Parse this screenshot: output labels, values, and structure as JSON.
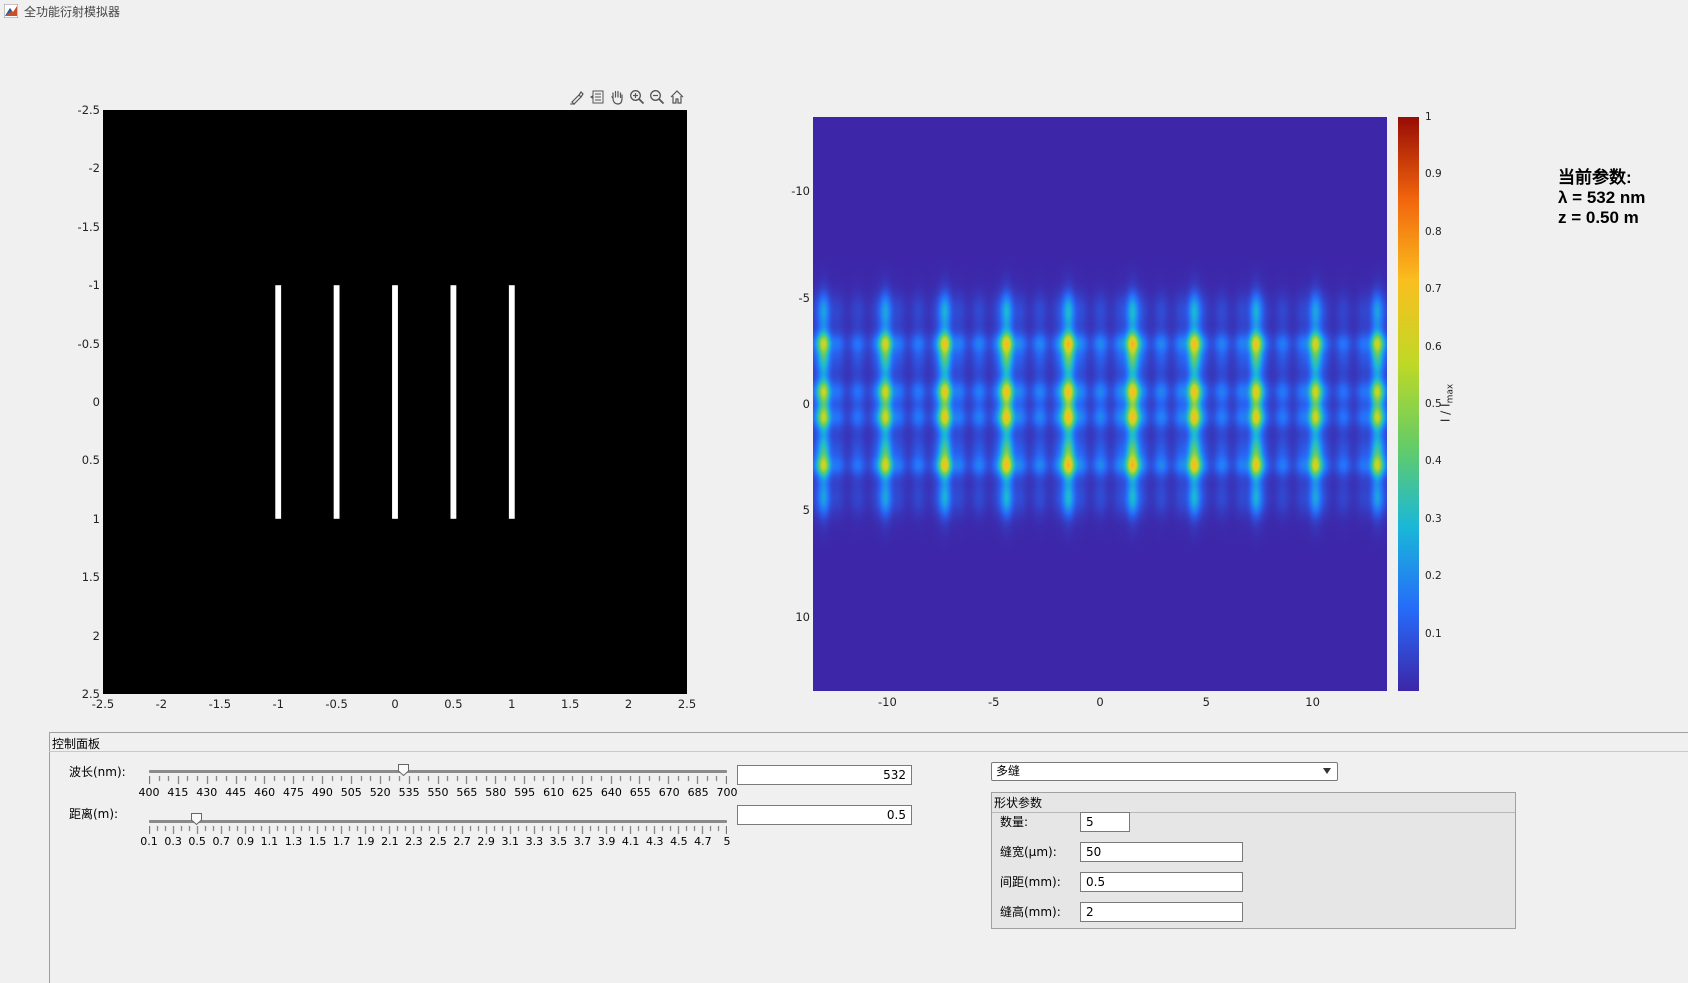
{
  "window": {
    "title": "全功能衍射模拟器"
  },
  "toolbar": {
    "icons": [
      "brush-icon",
      "datatip-icon",
      "pan-icon",
      "zoom-in-icon",
      "zoom-out-icon",
      "home-icon"
    ]
  },
  "aperture_plot": {
    "x_ticks": [
      "-2.5",
      "-2",
      "-1.5",
      "-1",
      "-0.5",
      "0",
      "0.5",
      "1",
      "1.5",
      "2",
      "2.5"
    ],
    "y_ticks": [
      "-2.5",
      "-2",
      "-1.5",
      "-1",
      "-0.5",
      "0",
      "0.5",
      "1",
      "1.5",
      "2",
      "2.5"
    ],
    "background": "#000000",
    "slit_color": "#ffffff"
  },
  "chart_data": [
    {
      "type": "heatmap",
      "title": "",
      "xlim": [
        -13.5,
        13.5
      ],
      "ylim": [
        13.5,
        -13.5
      ],
      "x_ticks": [
        "-10",
        "-5",
        "0",
        "5",
        "10"
      ],
      "y_ticks": [
        "-10",
        "-5",
        "0",
        "5",
        "10"
      ],
      "colormap": "parula",
      "colorbar": {
        "label": "I / I",
        "label_sub": "max",
        "ticks": [
          "0.1",
          "0.2",
          "0.3",
          "0.4",
          "0.5",
          "0.6",
          "0.7",
          "0.8",
          "0.9",
          "1"
        ],
        "range": [
          0,
          1
        ]
      },
      "fringe_x_positions": [
        -13.0,
        -10.1,
        -7.3,
        -4.4,
        -1.5,
        1.5,
        4.4,
        7.3,
        10.1,
        13.0
      ],
      "fringe_y_positions": [
        -3.0,
        -0.75,
        0.75,
        3.0
      ]
    }
  ],
  "params": {
    "heading": "当前参数:",
    "wavelength": "λ = 532 nm",
    "distance": "z = 0.50 m"
  },
  "control_panel": {
    "title": "控制面板",
    "wavelength_label": "波长(nm):",
    "wavelength_value": "532",
    "wavelength_min": 400,
    "wavelength_max": 700,
    "wavelength_tick_labels": [
      "400",
      "415",
      "430",
      "445",
      "460",
      "475",
      "490",
      "505",
      "520",
      "535",
      "550",
      "565",
      "580",
      "595",
      "610",
      "625",
      "640",
      "655",
      "670",
      "685",
      "700"
    ],
    "distance_label": "距离(m):",
    "distance_value": "0.5",
    "distance_min": 0.1,
    "distance_max": 5,
    "distance_tick_labels": [
      "0.1",
      "0.3",
      "0.5",
      "0.7",
      "0.9",
      "1.1",
      "1.3",
      "1.5",
      "1.7",
      "1.9",
      "2.1",
      "2.3",
      "2.5",
      "2.7",
      "2.9",
      "3.1",
      "3.3",
      "3.5",
      "3.7",
      "3.9",
      "4.1",
      "4.3",
      "4.5",
      "4.7",
      "5"
    ],
    "shape_selected": "多缝",
    "shape_group": {
      "title": "形状参数",
      "fields": [
        {
          "label": "数量:",
          "value": "5"
        },
        {
          "label": "缝宽(μm):",
          "value": "50"
        },
        {
          "label": "间距(mm):",
          "value": "0.5"
        },
        {
          "label": "缝高(mm):",
          "value": "2"
        }
      ]
    }
  }
}
